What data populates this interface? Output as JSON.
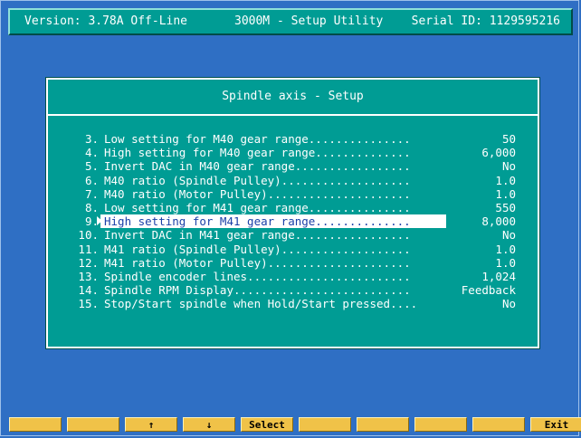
{
  "header": {
    "version": "Version: 3.78A Off-Line",
    "title": "3000M - Setup Utility",
    "serial": "Serial ID: 1129595216"
  },
  "dialog": {
    "title": "Spindle axis - Setup",
    "rows": [
      {
        "num": "3.",
        "label": "Low setting for M40 gear range...............",
        "value": "50"
      },
      {
        "num": "4.",
        "label": "High setting for M40 gear range..............",
        "value": "6,000"
      },
      {
        "num": "5.",
        "label": "Invert DAC in M40 gear range.................",
        "value": "No"
      },
      {
        "num": "6.",
        "label": "M40 ratio (Spindle Pulley)...................",
        "value": "1.0"
      },
      {
        "num": "7.",
        "label": "M40 ratio (Motor Pulley).....................",
        "value": "1.0"
      },
      {
        "num": "8.",
        "label": "Low setting for M41 gear range...............",
        "value": "550"
      },
      {
        "num": "9.",
        "label": "High setting for M41 gear range..............",
        "value": "8,000"
      },
      {
        "num": "10.",
        "label": "Invert DAC in M41 gear range.................",
        "value": "No"
      },
      {
        "num": "11.",
        "label": "M41 ratio (Spindle Pulley)...................",
        "value": "1.0"
      },
      {
        "num": "12.",
        "label": "M41 ratio (Motor Pulley).....................",
        "value": "1.0"
      },
      {
        "num": "13.",
        "label": "Spindle encoder lines........................",
        "value": "1,024"
      },
      {
        "num": "14.",
        "label": "Spindle RPM Display..........................",
        "value": "Feedback"
      },
      {
        "num": "15.",
        "label": "Stop/Start spindle when Hold/Start pressed....",
        "value": "No"
      }
    ],
    "selected_index": 6
  },
  "fkeys": [
    "",
    "",
    "↑",
    "↓",
    "Select",
    "",
    "",
    "",
    "",
    "Exit"
  ],
  "colors": {
    "background": "#2f6fc4",
    "panel": "#009c94",
    "fkey": "#f0c248",
    "highlight_text": "#1a3fa8"
  }
}
